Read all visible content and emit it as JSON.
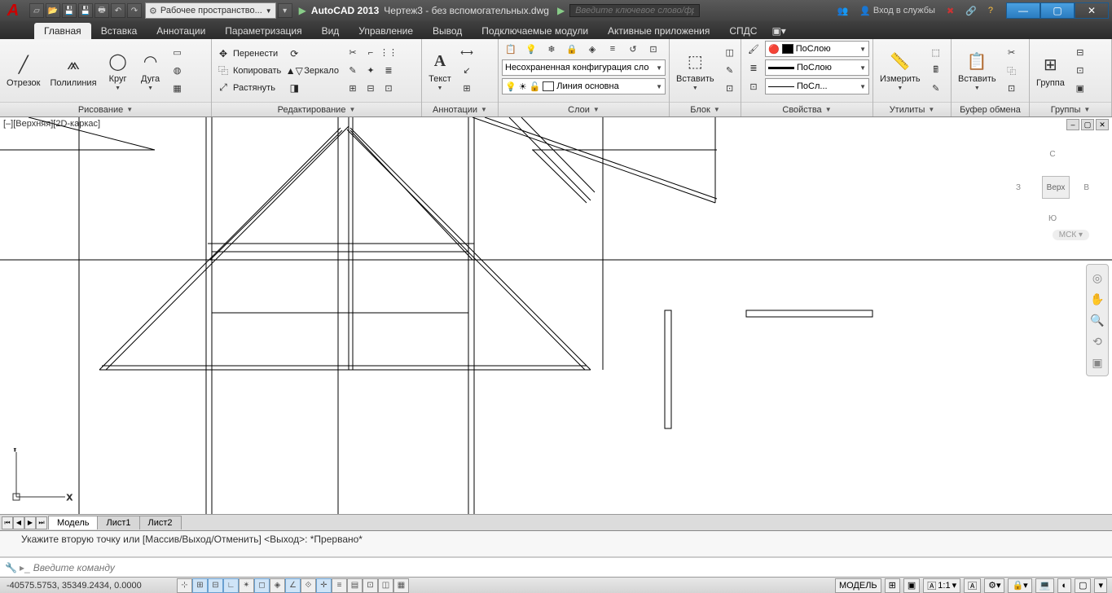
{
  "app": {
    "name": "AutoCAD 2013",
    "doc": "Чертеж3 - без вспомогательных.dwg"
  },
  "workspace": "Рабочее пространство...",
  "search_placeholder": "Введите ключевое слово/фразу",
  "login": "Вход в службы",
  "tabs": {
    "home": "Главная",
    "insert": "Вставка",
    "annotate": "Аннотации",
    "param": "Параметризация",
    "view": "Вид",
    "manage": "Управление",
    "output": "Вывод",
    "plugins": "Подключаемые модули",
    "online": "Активные приложения",
    "spds": "СПДС"
  },
  "draw": {
    "panel": "Рисование",
    "line": "Отрезок",
    "pline": "Полилиния",
    "circle": "Круг",
    "arc": "Дуга"
  },
  "modify": {
    "panel": "Редактирование",
    "move": "Перенести",
    "copy": "Копировать",
    "stretch": "Растянуть",
    "rotate": "",
    "mirror": "Зеркало",
    "scale": ""
  },
  "annot": {
    "panel": "Аннотации",
    "text": "Текст"
  },
  "layers": {
    "panel": "Слои",
    "unsaved": "Несохраненная конфигурация сло",
    "linetype": "Линия основна"
  },
  "block": {
    "panel": "Блок",
    "insert": "Вставить"
  },
  "props": {
    "panel": "Свойства",
    "bylayer": "ПоСлою",
    "bylayer2": "ПоСлою",
    "bylayer3": "ПоСл..."
  },
  "util": {
    "panel": "Утилиты",
    "measure": "Измерить"
  },
  "clip": {
    "panel": "Буфер обмена",
    "paste": "Вставить"
  },
  "groups": {
    "panel": "Группы",
    "group": "Группа"
  },
  "viewport": "[–][Верхняя][2D-каркас]",
  "viewcube": {
    "top": "Верх",
    "n": "С",
    "s": "Ю",
    "e": "В",
    "w": "З",
    "wcs": "МСК"
  },
  "layout": {
    "model": "Модель",
    "l1": "Лист1",
    "l2": "Лист2"
  },
  "cmd": {
    "history": "Укажите вторую точку или [Массив/Выход/Отменить] <Выход>: *Прервано*",
    "prompt": "Введите команду"
  },
  "status": {
    "coords": "-40575.5753, 35349.2434, 0.0000",
    "model": "МОДЕЛЬ",
    "scale": "1:1"
  }
}
